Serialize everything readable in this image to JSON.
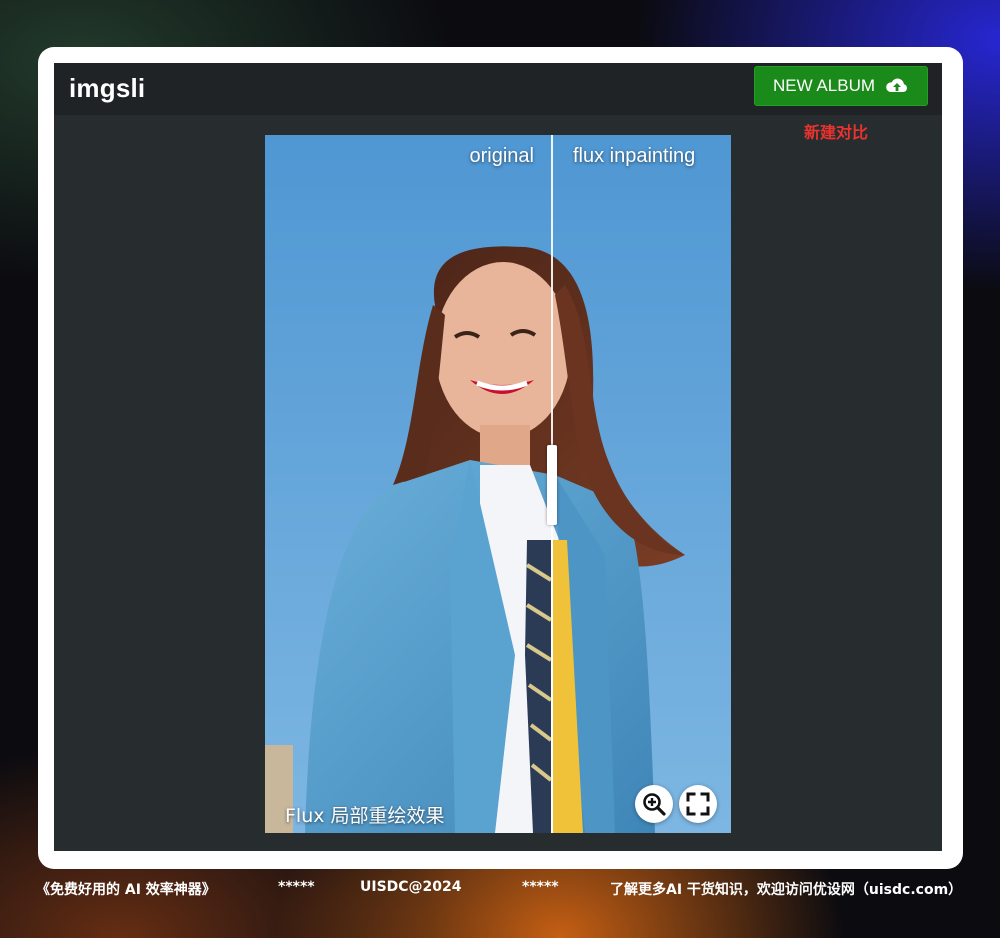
{
  "app": {
    "brand": "imgsli",
    "new_album_label": "NEW ALBUM",
    "annotation": "新建对比"
  },
  "viewer": {
    "left_label": "original",
    "right_label": "flux inpainting",
    "caption": "Flux 局部重绘效果",
    "split_position": 0.615
  },
  "icons": {
    "upload": "cloud-upload-icon",
    "zoom": "zoom-in-icon",
    "fullscreen": "fullscreen-icon"
  },
  "footer": {
    "left": "《免费好用的 AI 效率神器》",
    "stars_1": "*****",
    "center": "UISDC@2024",
    "stars_2": "*****",
    "right": "了解更多AI 干货知识，欢迎访问优设网（uisdc.com）"
  },
  "colors": {
    "button_green": "#1a8a1a",
    "annotation_red": "#e8332f",
    "app_background": "#272c2f",
    "navbar": "#1f2326",
    "sky_blue": "#5ea3d8",
    "tie_original": "#2b3a55",
    "tie_inpainted": "#f0c23a"
  }
}
